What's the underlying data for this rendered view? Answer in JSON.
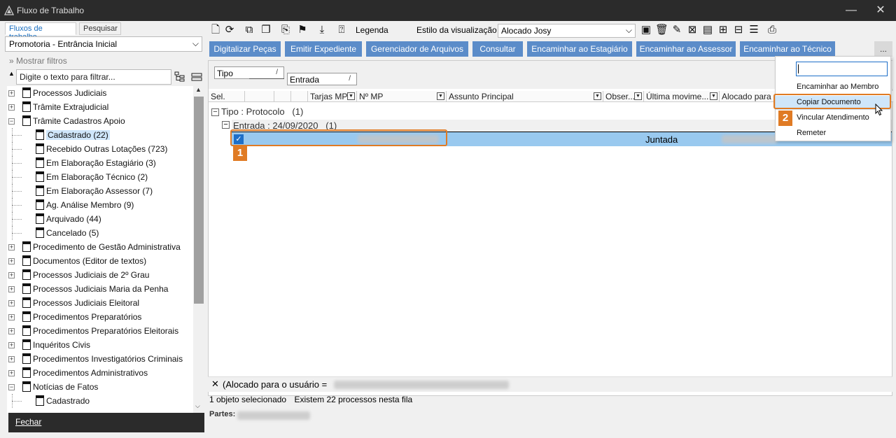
{
  "window": {
    "title": "Fluxo de Trabalho",
    "minimize": "—",
    "close": "✕"
  },
  "left": {
    "tabs": [
      "Fluxos de trabalho",
      "Pesquisar"
    ],
    "dropdown": "Promotoria - Entrância Inicial",
    "show_filters": "Mostrar filtros",
    "filter_placeholder": "Digite o texto para filtrar...",
    "tree": [
      {
        "label": "Processos Judiciais",
        "level": 0,
        "exp": "+"
      },
      {
        "label": "Trâmite Extrajudicial",
        "level": 0,
        "exp": "+"
      },
      {
        "label": "Trâmite Cadastros Apoio",
        "level": 0,
        "exp": "−"
      },
      {
        "label": "Cadastrado (22)",
        "level": 1,
        "selected": true
      },
      {
        "label": "Recebido Outras Lotações (723)",
        "level": 1
      },
      {
        "label": "Em Elaboração Estagiário (3)",
        "level": 1
      },
      {
        "label": "Em Elaboração Técnico (2)",
        "level": 1
      },
      {
        "label": "Em Elaboração Assessor (7)",
        "level": 1
      },
      {
        "label": "Ag. Análise Membro (9)",
        "level": 1
      },
      {
        "label": "Arquivado (44)",
        "level": 1
      },
      {
        "label": "Cancelado (5)",
        "level": 1
      },
      {
        "label": "Procedimento de Gestão Administrativa",
        "level": 0,
        "exp": "+"
      },
      {
        "label": "Documentos (Editor de textos)",
        "level": 0,
        "exp": "+"
      },
      {
        "label": "Processos Judiciais de 2º Grau",
        "level": 0,
        "exp": "+"
      },
      {
        "label": "Processos Judiciais Maria da Penha",
        "level": 0,
        "exp": "+"
      },
      {
        "label": "Processos Judiciais Eleitoral",
        "level": 0,
        "exp": "+"
      },
      {
        "label": "Procedimentos Preparatórios",
        "level": 0,
        "exp": "+"
      },
      {
        "label": "Procedimentos Preparatórios Eleitorais",
        "level": 0,
        "exp": "+"
      },
      {
        "label": "Inquéritos Civis",
        "level": 0,
        "exp": "+"
      },
      {
        "label": "Procedimentos Investigatórios Criminais",
        "level": 0,
        "exp": "+"
      },
      {
        "label": "Procedimentos Administrativos",
        "level": 0,
        "exp": "+"
      },
      {
        "label": "Notícias de Fatos",
        "level": 0,
        "exp": "−"
      },
      {
        "label": "Cadastrado",
        "level": 1
      }
    ],
    "close_button": "Fechar"
  },
  "toolbar": {
    "legend": "Legenda",
    "view_style_label": "Estilo da visualização",
    "view_style_value": "Alocado Josy"
  },
  "actions": [
    "Digitalizar Peças",
    "Emitir Expediente",
    "Gerenciador de Arquivos",
    "Consultar",
    "Encaminhar ao Estagiário",
    "Encaminhar ao Assessor",
    "Encaminhar ao Técnico",
    "..."
  ],
  "grid": {
    "group_chips": [
      "Tipo",
      "Entrada"
    ],
    "columns": [
      "Sel.",
      "",
      "",
      "Tarjas MP",
      "Nº MP",
      "Assunto Principal",
      "Obser...",
      "Última movime...",
      "Alocado para o"
    ],
    "group1": "Tipo : Protocolo   (1)",
    "group2": "Entrada : 24/09/2020   (1)",
    "row_movement": "Juntada"
  },
  "callouts": [
    "1",
    "2"
  ],
  "popup": {
    "items": [
      "Encaminhar ao Membro",
      "Copiar Documento",
      "Vincular Atendimento",
      "Remeter"
    ]
  },
  "footer": {
    "filter_text": "(Alocado para o usuário =",
    "status_selected": "1 objeto selecionado",
    "status_count": "Existem 22 processos nesta fila",
    "parts_label": "Partes:"
  },
  "colors": {
    "accent": "#5b8cc9",
    "callout": "#e07b24",
    "selection": "#99c9ef"
  }
}
